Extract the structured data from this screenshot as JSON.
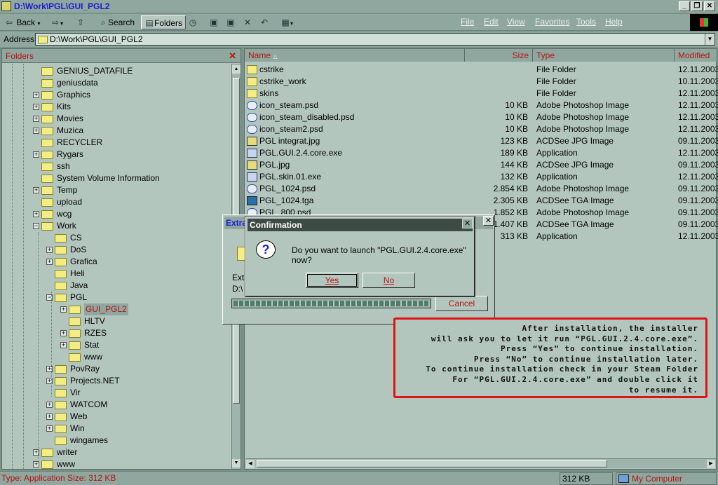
{
  "window": {
    "title": "D:\\Work\\PGL\\GUI_PGL2"
  },
  "toolbar": {
    "back": "Back",
    "search": "Search",
    "folders": "Folders",
    "menu": [
      "File",
      "Edit",
      "View",
      "Favorites",
      "Tools",
      "Help"
    ]
  },
  "address": {
    "label": "Address",
    "value": "D:\\Work\\PGL\\GUI_PGL2"
  },
  "folders_pane": {
    "title": "Folders",
    "items": [
      {
        "label": "GENIUS_DATAFILE",
        "level": 0,
        "exp": ""
      },
      {
        "label": "geniusdata",
        "level": 0,
        "exp": ""
      },
      {
        "label": "Graphics",
        "level": 0,
        "exp": "+"
      },
      {
        "label": "Kits",
        "level": 0,
        "exp": "+"
      },
      {
        "label": "Movies",
        "level": 0,
        "exp": "+"
      },
      {
        "label": "Muzica",
        "level": 0,
        "exp": "+"
      },
      {
        "label": "RECYCLER",
        "level": 0,
        "exp": ""
      },
      {
        "label": "Rygars",
        "level": 0,
        "exp": "+"
      },
      {
        "label": "ssh",
        "level": 0,
        "exp": ""
      },
      {
        "label": "System Volume Information",
        "level": 0,
        "exp": ""
      },
      {
        "label": "Temp",
        "level": 0,
        "exp": "+"
      },
      {
        "label": "upload",
        "level": 0,
        "exp": ""
      },
      {
        "label": "wcg",
        "level": 0,
        "exp": "+"
      },
      {
        "label": "Work",
        "level": 0,
        "exp": "-"
      },
      {
        "label": "CS",
        "level": 1,
        "exp": ""
      },
      {
        "label": "DoS",
        "level": 1,
        "exp": "+"
      },
      {
        "label": "Grafica",
        "level": 1,
        "exp": "+"
      },
      {
        "label": "Heli",
        "level": 1,
        "exp": ""
      },
      {
        "label": "Java",
        "level": 1,
        "exp": ""
      },
      {
        "label": "PGL",
        "level": 1,
        "exp": "-"
      },
      {
        "label": "GUI_PGL2",
        "level": 2,
        "exp": "+",
        "selected": true
      },
      {
        "label": "HLTV",
        "level": 2,
        "exp": ""
      },
      {
        "label": "RZES",
        "level": 2,
        "exp": "+"
      },
      {
        "label": "Stat",
        "level": 2,
        "exp": "+"
      },
      {
        "label": "www",
        "level": 2,
        "exp": ""
      },
      {
        "label": "PovRay",
        "level": 1,
        "exp": "+"
      },
      {
        "label": "Projects.NET",
        "level": 1,
        "exp": "+"
      },
      {
        "label": "Vir",
        "level": 1,
        "exp": ""
      },
      {
        "label": "WATCOM",
        "level": 1,
        "exp": "+"
      },
      {
        "label": "Web",
        "level": 1,
        "exp": "+"
      },
      {
        "label": "Win",
        "level": 1,
        "exp": "+"
      },
      {
        "label": "wingames",
        "level": 1,
        "exp": ""
      },
      {
        "label": "writer",
        "level": 0,
        "exp": "+"
      },
      {
        "label": "www",
        "level": 0,
        "exp": "+"
      }
    ]
  },
  "file_list": {
    "columns": {
      "name": "Name",
      "size": "Size",
      "type": "Type",
      "modified": "Modified"
    },
    "rows": [
      {
        "icon": "folder",
        "name": "cstrike",
        "size": "",
        "type": "File Folder",
        "modified": "12.11.2003"
      },
      {
        "icon": "folder",
        "name": "cstrike_work",
        "size": "",
        "type": "File Folder",
        "modified": "10.11.2003"
      },
      {
        "icon": "folder",
        "name": "skins",
        "size": "",
        "type": "File Folder",
        "modified": "12.11.2003"
      },
      {
        "icon": "psd",
        "name": "icon_steam.psd",
        "size": "10 KB",
        "type": "Adobe Photoshop Image",
        "modified": "12.11.2003"
      },
      {
        "icon": "psd",
        "name": "icon_steam_disabled.psd",
        "size": "10 KB",
        "type": "Adobe Photoshop Image",
        "modified": "12.11.2003"
      },
      {
        "icon": "psd",
        "name": "icon_steam2.psd",
        "size": "10 KB",
        "type": "Adobe Photoshop Image",
        "modified": "12.11.2003"
      },
      {
        "icon": "jpg",
        "name": "PGL integrat.jpg",
        "size": "123 KB",
        "type": "ACDSee JPG Image",
        "modified": "09.11.2003"
      },
      {
        "icon": "exe",
        "name": "PGL.GUI.2.4.core.exe",
        "size": "189 KB",
        "type": "Application",
        "modified": "12.11.2003"
      },
      {
        "icon": "jpg",
        "name": "PGL.jpg",
        "size": "144 KB",
        "type": "ACDSee JPG Image",
        "modified": "09.11.2003"
      },
      {
        "icon": "exe",
        "name": "PGL.skin.01.exe",
        "size": "132 KB",
        "type": "Application",
        "modified": "12.11.2003"
      },
      {
        "icon": "psd",
        "name": "PGL_1024.psd",
        "size": "2.854 KB",
        "type": "Adobe Photoshop Image",
        "modified": "09.11.2003"
      },
      {
        "icon": "tga",
        "name": "PGL_1024.tga",
        "size": "2.305 KB",
        "type": "ACDSee TGA Image",
        "modified": "09.11.2003"
      },
      {
        "icon": "psd",
        "name": "PGL_800.psd",
        "size": "1.852 KB",
        "type": "Adobe Photoshop Image",
        "modified": "09.11.2003"
      },
      {
        "icon": "tga",
        "name": "",
        "size": "1.407 KB",
        "type": "ACDSee TGA Image",
        "modified": "09.11.2003"
      },
      {
        "icon": "",
        "name": "",
        "size": "313 KB",
        "type": "Application",
        "modified": "12.11.2003"
      }
    ]
  },
  "extract_dialog": {
    "title": "Extra",
    "line1": "Extra",
    "line2": "D:\\",
    "cancel": "Cancel",
    "progress": 1.0
  },
  "confirm_dialog": {
    "title": "Confirmation",
    "message": "Do you want to launch \"PGL.GUI.2.4.core.exe\" now?",
    "yes": "Yes",
    "no": "No"
  },
  "note": {
    "lines": [
      "After installation, the installer",
      "will ask you to let it run “PGL.GUI.2.4.core.exe”.",
      "Press “Yes” to continue installation.",
      "Press “No” to continue installation later.",
      "To continue installation check in your Steam Folder",
      "For “PGL.GUI.2.4.core.exe” and double click it",
      "to resume it."
    ]
  },
  "status": {
    "left": "Type: Application Size: 312 KB",
    "size": "312 KB",
    "zone": "My Computer"
  }
}
